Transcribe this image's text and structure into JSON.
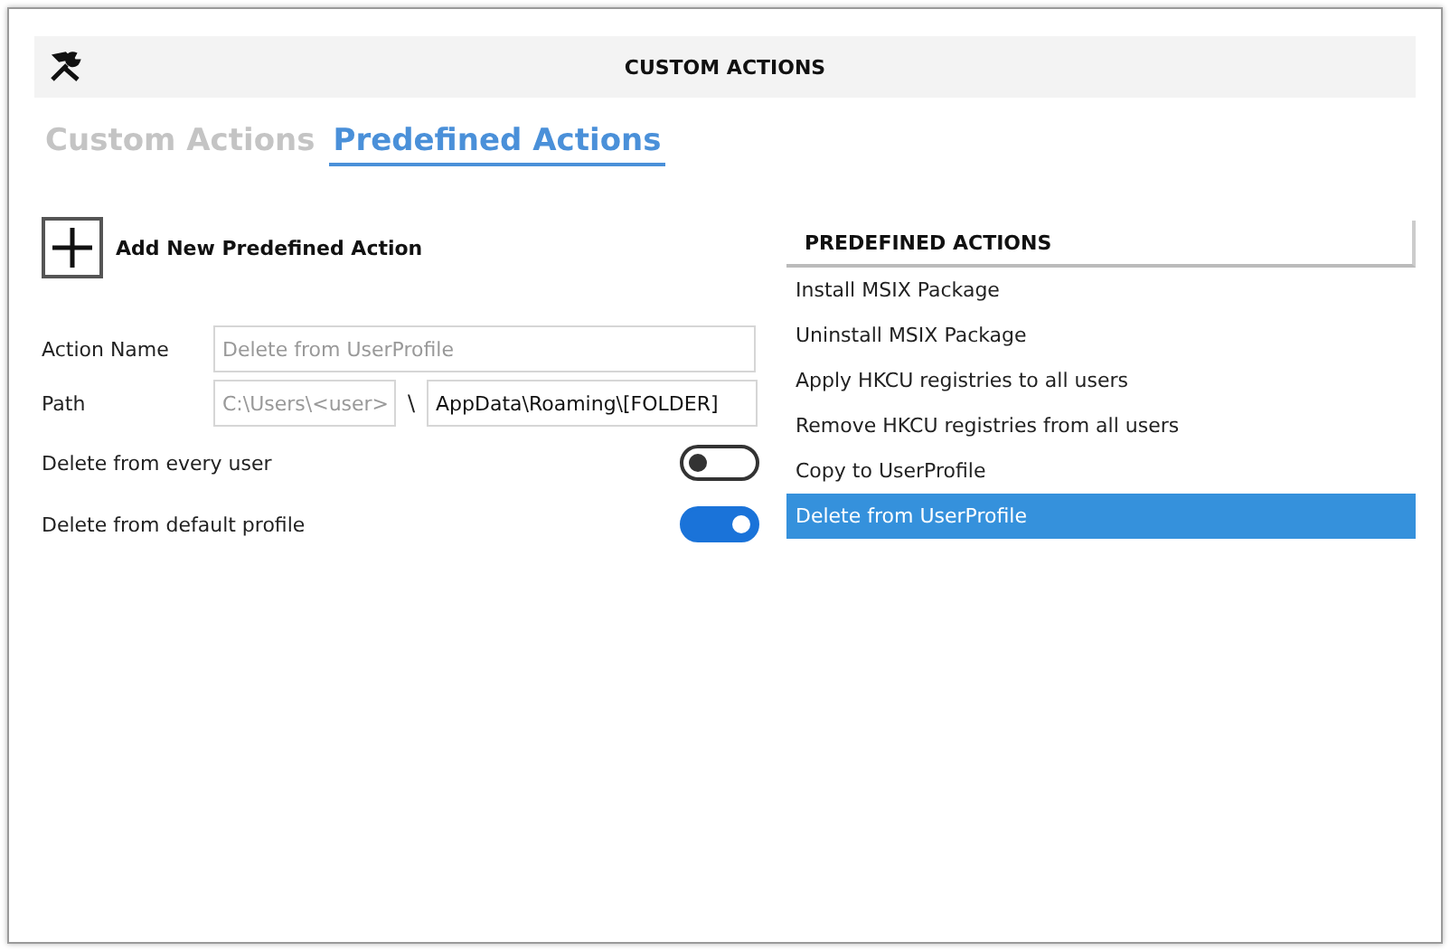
{
  "header": {
    "title": "CUSTOM ACTIONS"
  },
  "tabs": [
    {
      "label": "Custom Actions",
      "selected": false
    },
    {
      "label": "Predefined Actions",
      "selected": true
    }
  ],
  "add_button": {
    "label": "Add New Predefined Action"
  },
  "form": {
    "action_name": {
      "label": "Action Name",
      "placeholder": "Delete from UserProfile"
    },
    "path": {
      "label": "Path",
      "prefix_placeholder": "C:\\Users\\<user>",
      "separator": "\\",
      "value": "AppData\\Roaming\\[FOLDER]"
    },
    "toggles": [
      {
        "label": "Delete from every user",
        "on": false
      },
      {
        "label": "Delete from default profile",
        "on": true
      }
    ]
  },
  "list": {
    "header": "PREDEFINED ACTIONS",
    "items": [
      {
        "label": "Install MSIX Package",
        "selected": false
      },
      {
        "label": "Uninstall MSIX Package",
        "selected": false
      },
      {
        "label": "Apply HKCU registries to all users",
        "selected": false
      },
      {
        "label": "Remove HKCU registries from all users",
        "selected": false
      },
      {
        "label": "Copy to UserProfile",
        "selected": false
      },
      {
        "label": "Delete from UserProfile",
        "selected": true
      }
    ]
  }
}
